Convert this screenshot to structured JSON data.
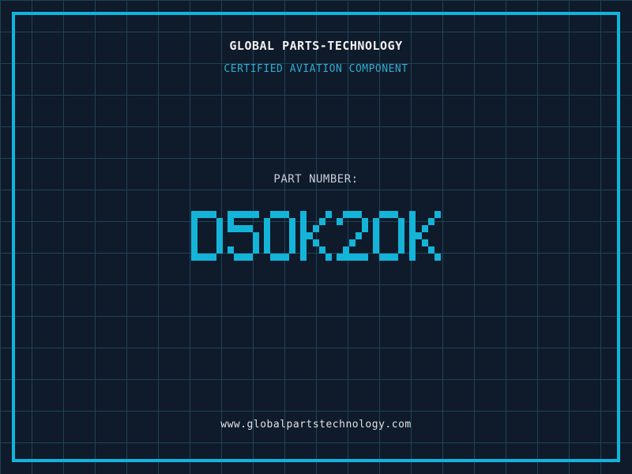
{
  "page": {
    "company_name": "GLOBAL PARTS-TECHNOLOGY",
    "subtitle": "CERTIFIED AVIATION COMPONENT",
    "part_number_label": "PART NUMBER:",
    "part_number": "D50K20K",
    "website": "www.globalpartstechnology.com"
  },
  "colors": {
    "background": "#0f1a2b",
    "grid_line": "#1c4657",
    "frame": "#0db6dc",
    "accent_cyan": "#14b4d8",
    "subtitle_cyan": "#2fadcf",
    "title_white": "#f2f2f2",
    "label_gray": "#c8ced6",
    "url_white": "#dfe3e7"
  }
}
